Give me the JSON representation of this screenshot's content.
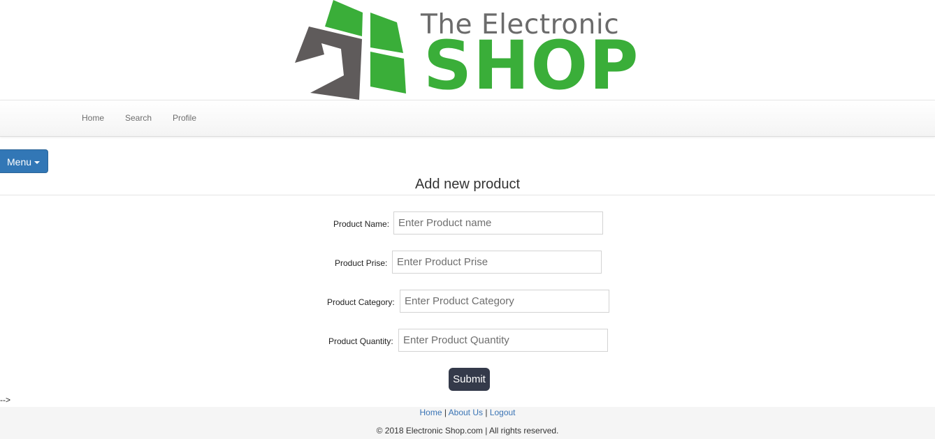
{
  "brand": {
    "top_text": "The Electronic",
    "main_text": "SHOP",
    "colors": {
      "green": "#3aae39",
      "gray": "#6b6b6b"
    }
  },
  "navbar": {
    "items": [
      {
        "label": "Home"
      },
      {
        "label": "Search"
      },
      {
        "label": "Profile"
      }
    ]
  },
  "menu_button": {
    "label": "Menu",
    "icon": "caret-down-icon",
    "color": "#3277b6"
  },
  "form": {
    "title": "Add new product",
    "fields": [
      {
        "label": "Product Name:",
        "placeholder": "Enter Product name",
        "value": ""
      },
      {
        "label": "Product Prise:",
        "placeholder": "Enter Product Prise",
        "value": ""
      },
      {
        "label": "Product Category:",
        "placeholder": "Enter Product Category",
        "value": ""
      },
      {
        "label": "Product Quantity:",
        "placeholder": "Enter Product Quantity",
        "value": ""
      }
    ],
    "submit_label": "Submit"
  },
  "stray_text": "-->",
  "footer": {
    "links": [
      {
        "label": "Home"
      },
      {
        "label": "About Us"
      },
      {
        "label": "Logout"
      }
    ],
    "separator": "|",
    "copyright": "© 2018 Electronic Shop.com | All rights reserved."
  }
}
